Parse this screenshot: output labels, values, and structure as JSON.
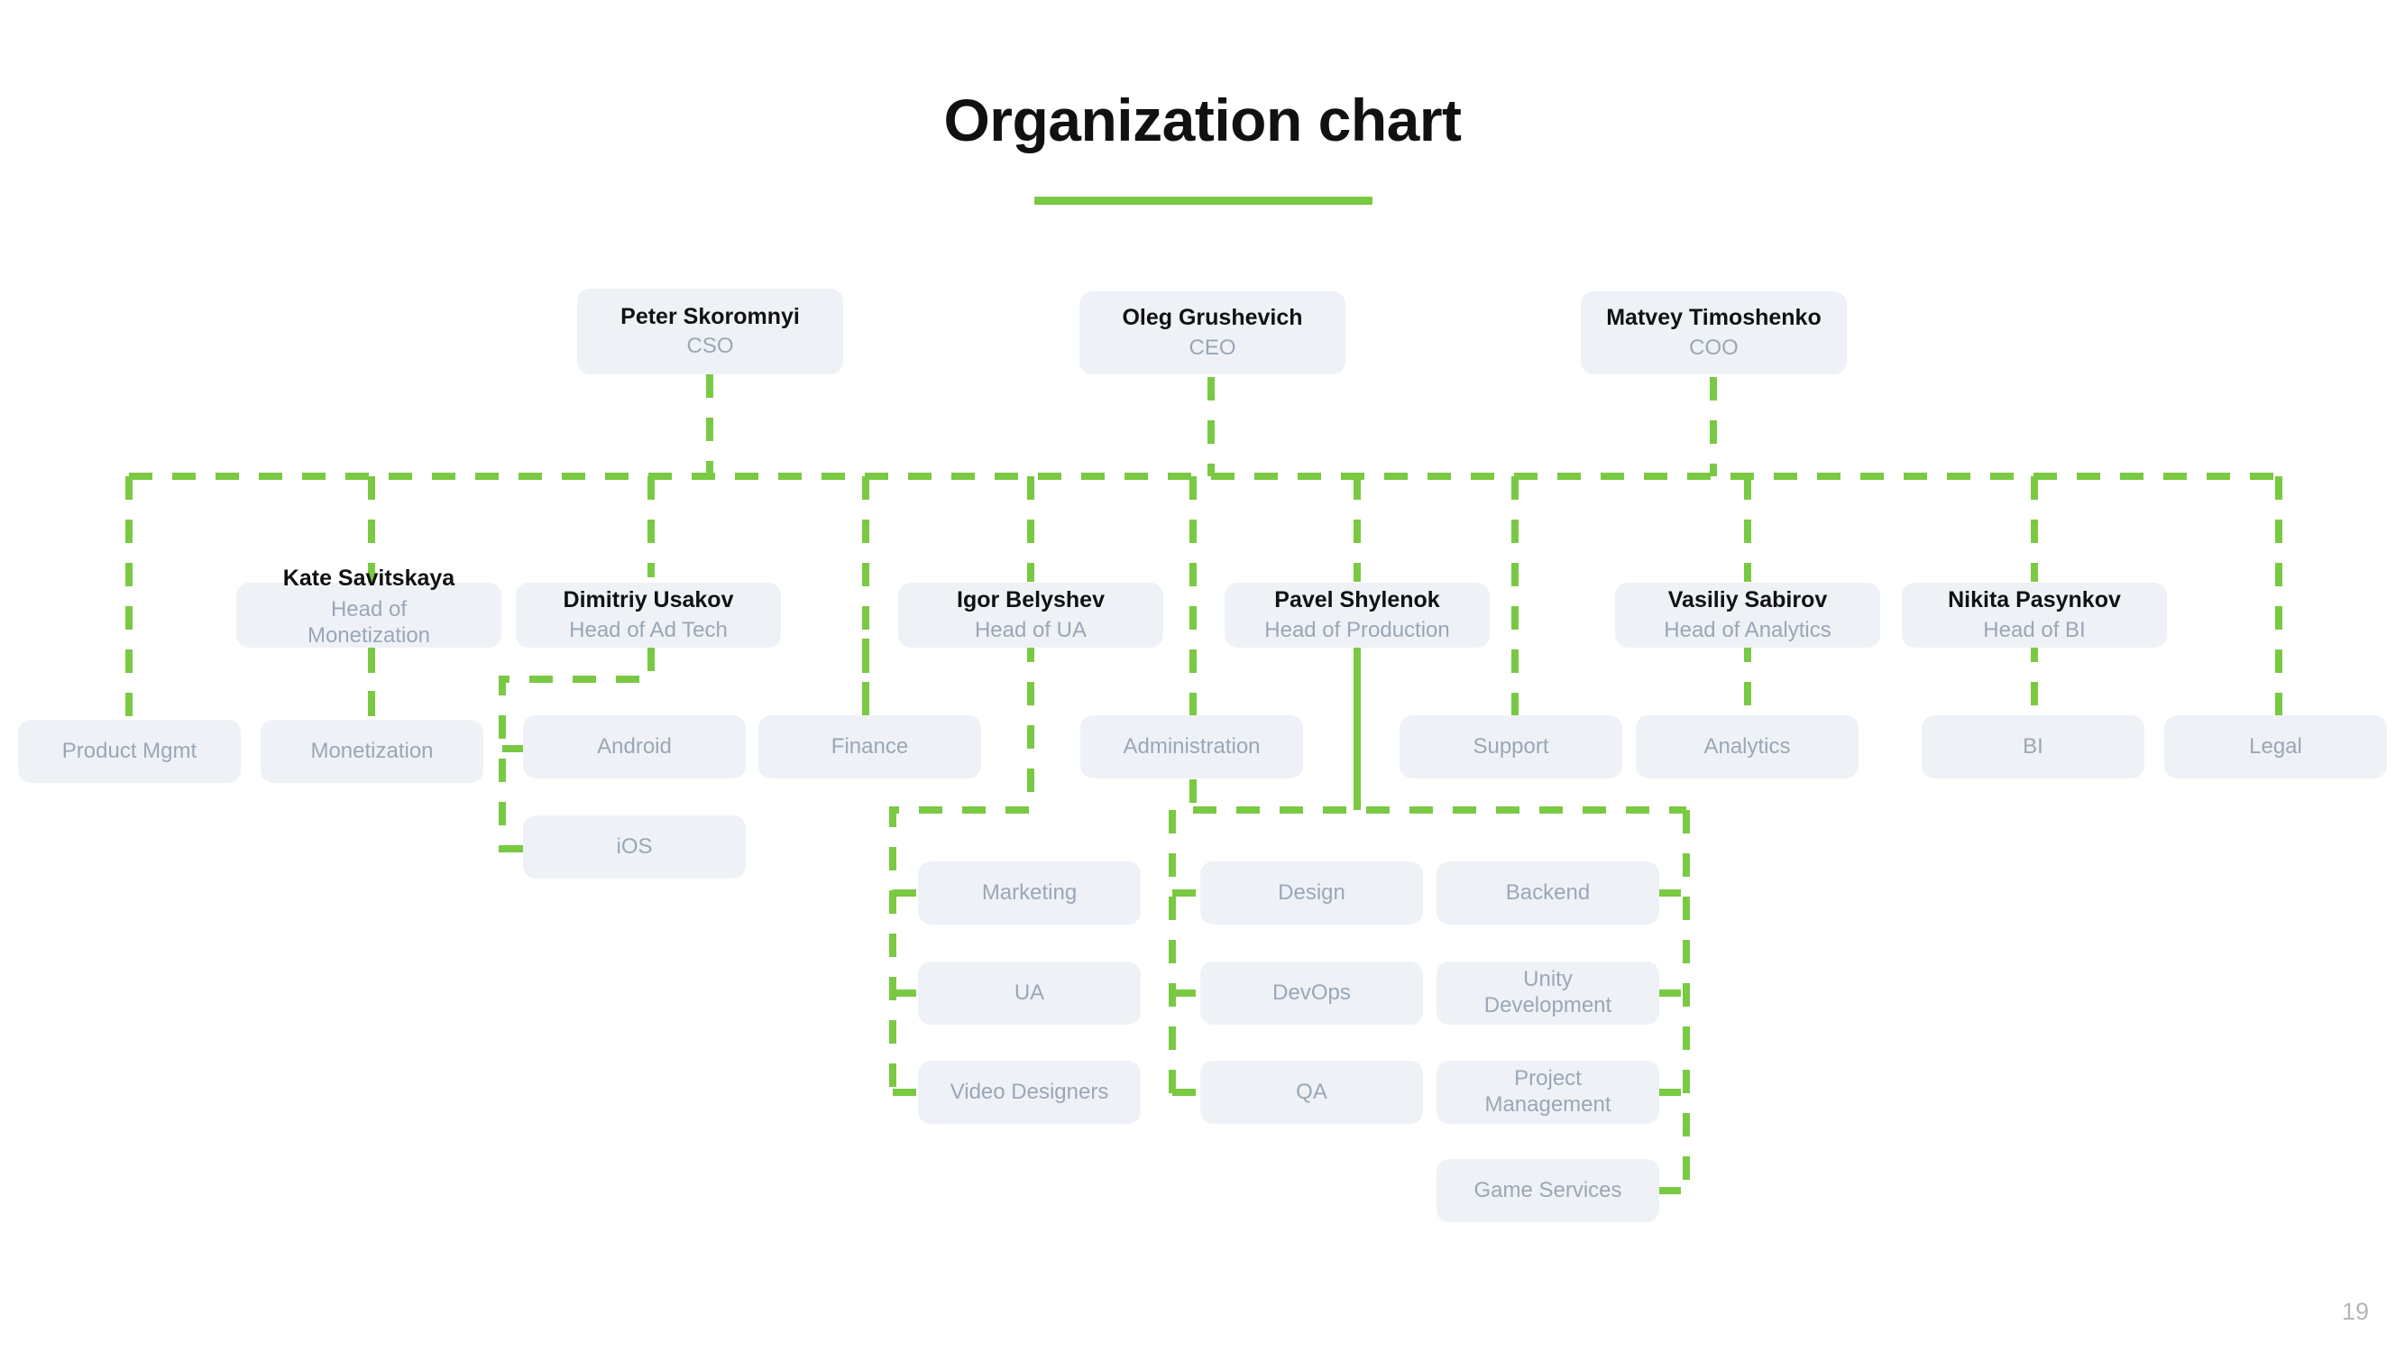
{
  "slide": {
    "title": "Organization chart",
    "page_number": "19",
    "accent_color": "#7ac943",
    "node_bg": "#eef2f7",
    "name_color": "#111111",
    "role_color": "#9aa7b5"
  },
  "executives": [
    {
      "name": "Peter Skoromnyi",
      "role": "CSO"
    },
    {
      "name": "Oleg Grushevich",
      "role": "CEO"
    },
    {
      "name": "Matvey Timoshenko",
      "role": "COO"
    }
  ],
  "heads": [
    {
      "name": "Kate Savitskaya",
      "role": "Head of Monetization"
    },
    {
      "name": "Dimitriy Usakov",
      "role": "Head of Ad Tech"
    },
    {
      "name": "Igor Belyshev",
      "role": "Head of UA"
    },
    {
      "name": "Pavel Shylenok",
      "role": "Head of Production"
    },
    {
      "name": "Vasiliy Sabirov",
      "role": "Head of Analytics"
    },
    {
      "name": "Nikita Pasynkov",
      "role": "Head of BI"
    }
  ],
  "departments": [
    {
      "label": "Product Mgmt"
    },
    {
      "label": "Monetization"
    },
    {
      "label": "Android"
    },
    {
      "label": "Finance"
    },
    {
      "label": "Administration"
    },
    {
      "label": "Support"
    },
    {
      "label": "Analytics"
    },
    {
      "label": "BI"
    },
    {
      "label": "Legal"
    },
    {
      "label": "iOS"
    }
  ],
  "ua_teams": [
    {
      "label": "Marketing"
    },
    {
      "label": "UA"
    },
    {
      "label": "Video Designers"
    }
  ],
  "production_teams_left": [
    {
      "label": "Design"
    },
    {
      "label": "DevOps"
    },
    {
      "label": "QA"
    }
  ],
  "production_teams_right": [
    {
      "label": "Backend"
    },
    {
      "label": "Unity Development"
    },
    {
      "label": "Project Management"
    }
  ]
}
